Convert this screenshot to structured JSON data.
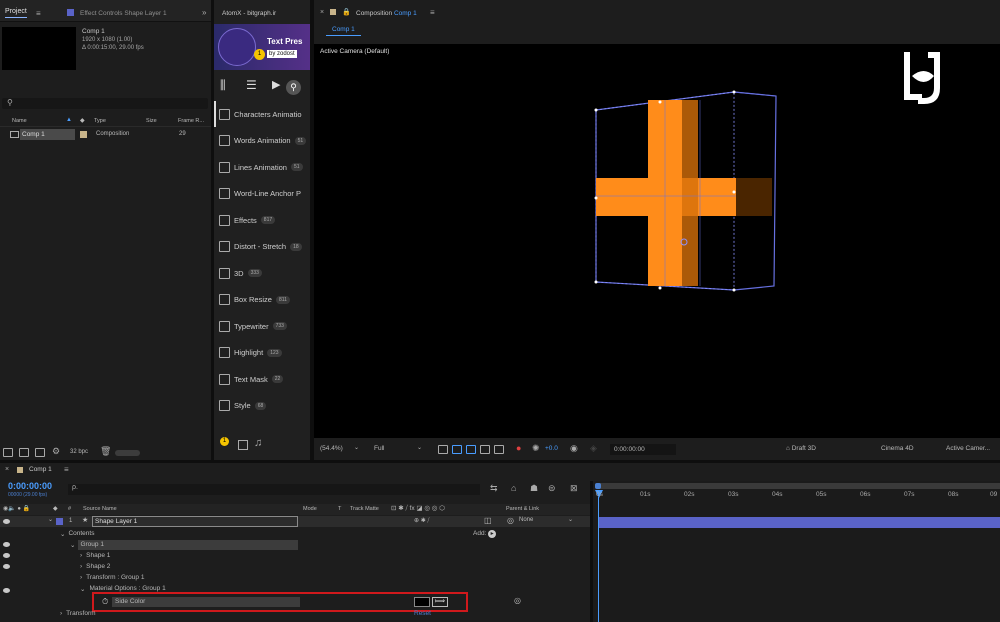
{
  "project": {
    "tab_label": "Project",
    "effect_controls_label": "Effect Controls Shape Layer 1",
    "comp_name": "Comp 1",
    "comp_info_1": "1920 x 1080 (1.00)",
    "comp_info_2": "Δ 0:00:15:00, 29.00 fps",
    "col_name": "Name",
    "col_type": "Type",
    "col_size": "Size",
    "col_framerate": "Frame R...",
    "item_name": "Comp 1",
    "item_type": "Composition",
    "item_fps": "29",
    "bpc": "32 bpc"
  },
  "atomx": {
    "tab_label": "AtomX - bitgraph.ir",
    "banner_title": "Text Pres",
    "banner_by": "by zodost",
    "badge": "1",
    "categories": [
      {
        "label": "Characters Animatio",
        "count": ""
      },
      {
        "label": "Words Animation",
        "count": "51"
      },
      {
        "label": "Lines Animation",
        "count": "51"
      },
      {
        "label": "Word-Line Anchor P",
        "count": ""
      },
      {
        "label": "Effects",
        "count": "817"
      },
      {
        "label": "Distort - Stretch",
        "count": "18"
      },
      {
        "label": "3D",
        "count": "333"
      },
      {
        "label": "Box Resize",
        "count": "811"
      },
      {
        "label": "Typewriter",
        "count": "733"
      },
      {
        "label": "Highlight",
        "count": "123"
      },
      {
        "label": "Text Mask",
        "count": "22"
      },
      {
        "label": "Style",
        "count": "68"
      }
    ]
  },
  "composition": {
    "tab_label": "Composition",
    "tab_comp": "Comp 1",
    "subtab": "Comp 1",
    "camera_label": "Active Camera (Default)",
    "zoom": "(54.4%)",
    "resolution": "Full",
    "exposure": "+0.0",
    "timecode": "0:00:00:00",
    "draft": "Draft 3D",
    "renderer": "Cinema 4D",
    "camera_select": "Active Camer..."
  },
  "timeline": {
    "tab_label": "Comp 1",
    "timecode": "0:00:00:00",
    "timecode_sub": "00000 (29.00 fps)",
    "search_placeholder": "ρ.",
    "col_source": "Source Name",
    "col_mode": "Mode",
    "col_t": "T",
    "col_trackmatte": "Track Matte",
    "col_parent": "Parent & Link",
    "layer_num": "1",
    "layer_name": "Shape Layer 1",
    "parent_value": "None",
    "add_label": "Add:",
    "tree": [
      "Contents",
      "Group 1",
      "Shape 1",
      "Shape 2",
      "Transform : Group 1",
      "Material Options : Group 1",
      "Side Color",
      "Transform"
    ],
    "reset_label": "Reset",
    "ruler": [
      "0s",
      "01s",
      "02s",
      "03s",
      "04s",
      "05s",
      "06s",
      "07s",
      "08s",
      "09"
    ]
  },
  "colors": {
    "accent": "#4a9dff",
    "orange": "#ff8c1a",
    "highlight_red": "#d0191c",
    "layer_bar": "#5a63c8"
  }
}
